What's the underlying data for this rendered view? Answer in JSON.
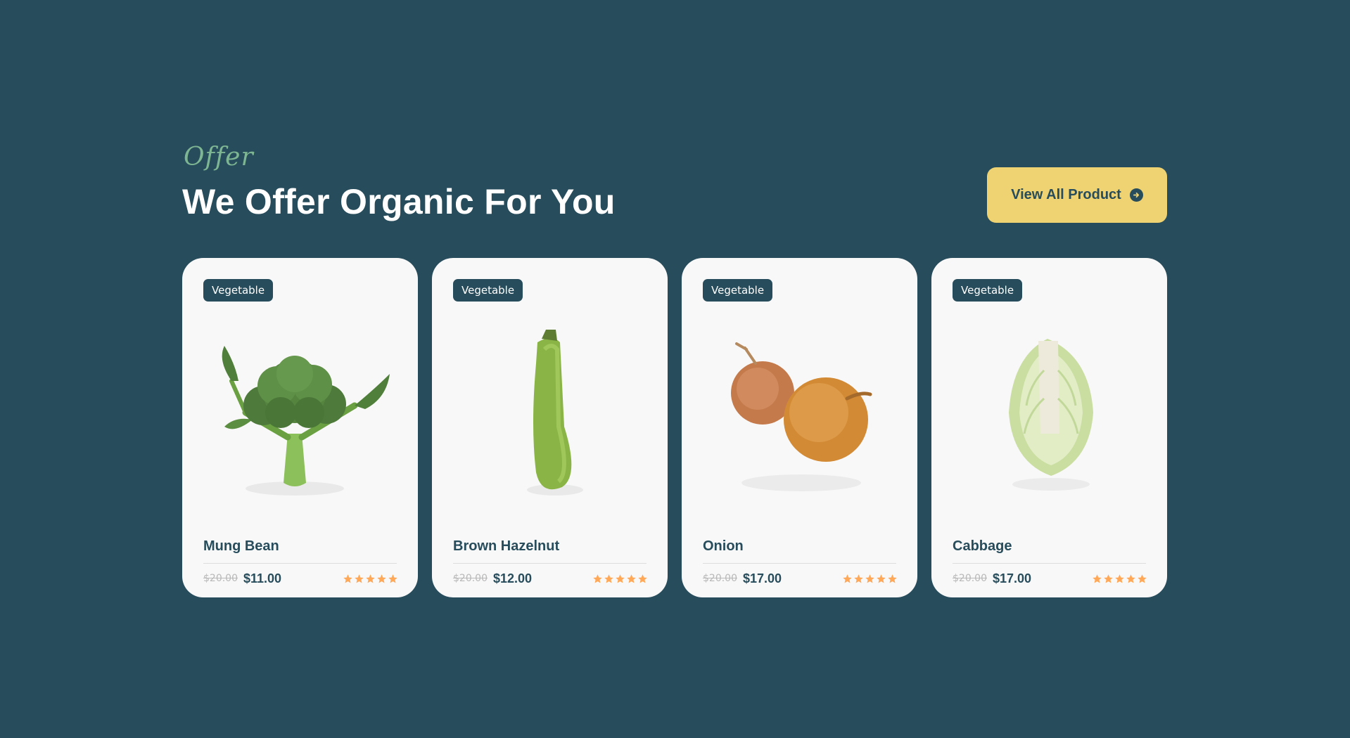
{
  "section": {
    "subtitle": "Offer",
    "title": "We Offer Organic For You",
    "view_button_label": "View All Product"
  },
  "colors": {
    "background": "#274c5b",
    "accent_green": "#7eb693",
    "button_yellow": "#efd372",
    "star_orange": "#ffa858",
    "card_bg": "#f9f8f8"
  },
  "products": [
    {
      "category": "Vegetable",
      "name": "Mung Bean",
      "old_price": "$20.00",
      "price": "$11.00",
      "rating": 5,
      "image": "broccoli-image"
    },
    {
      "category": "Vegetable",
      "name": "Brown Hazelnut",
      "old_price": "$20.00",
      "price": "$12.00",
      "rating": 5,
      "image": "zucchini-image"
    },
    {
      "category": "Vegetable",
      "name": "Onion",
      "old_price": "$20.00",
      "price": "$17.00",
      "rating": 5,
      "image": "onion-image"
    },
    {
      "category": "Vegetable",
      "name": "Cabbage",
      "old_price": "$20.00",
      "price": "$17.00",
      "rating": 5,
      "image": "cabbage-image"
    }
  ]
}
